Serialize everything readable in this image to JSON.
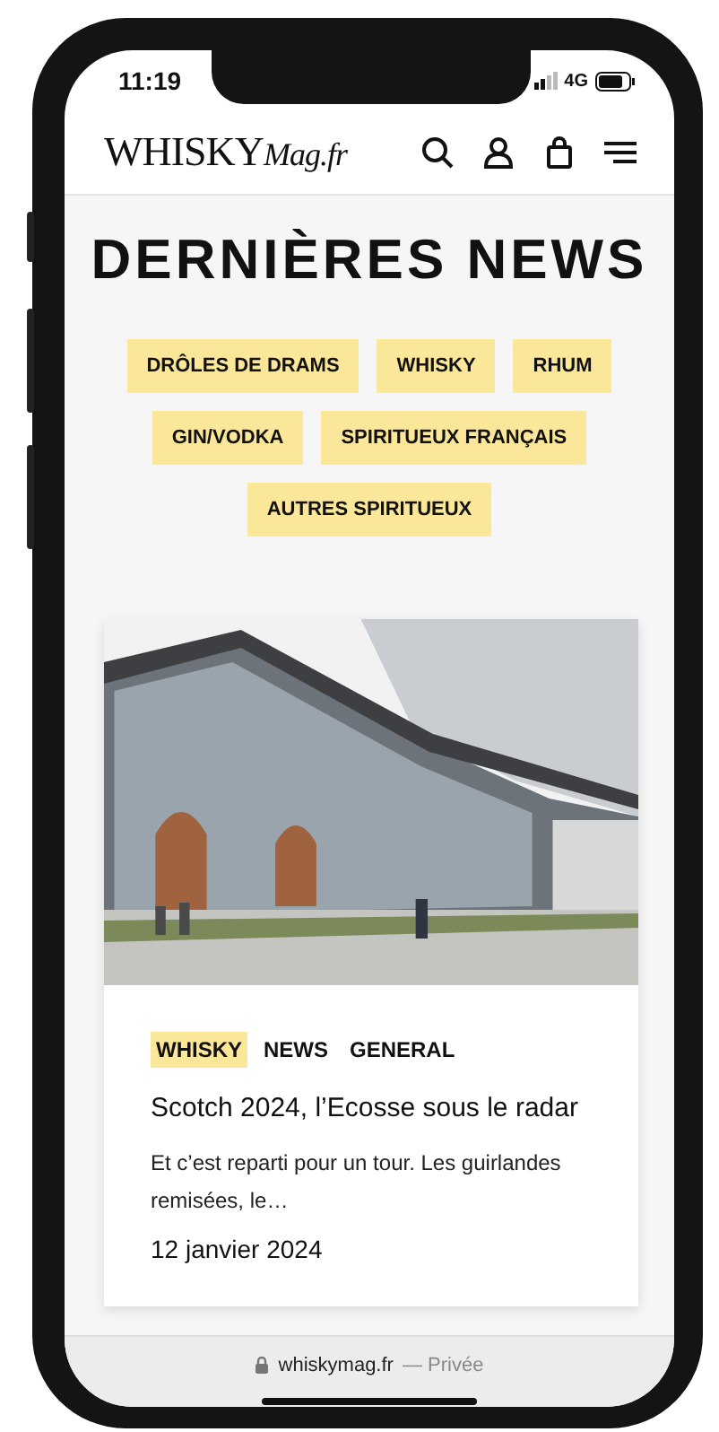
{
  "status_bar": {
    "time": "11:19",
    "network": "4G"
  },
  "header": {
    "logo": "WHISKY",
    "logo_suffix": "Mag.fr"
  },
  "page": {
    "title": "DERNIÈRES NEWS",
    "categories": [
      {
        "label": "DRÔLES DE DRAMS"
      },
      {
        "label": "WHISKY"
      },
      {
        "label": "RHUM"
      },
      {
        "label": "GIN/VODKA"
      },
      {
        "label": "SPIRITUEUX FRANÇAIS"
      },
      {
        "label": "AUTRES SPIRITUEUX"
      }
    ]
  },
  "articles": [
    {
      "tags": [
        {
          "label": "WHISKY",
          "highlighted": true
        },
        {
          "label": "NEWS",
          "highlighted": false
        },
        {
          "label": "GENERAL",
          "highlighted": false
        }
      ],
      "title": "Scotch 2024, l’Ecosse sous le radar",
      "excerpt": "Et c’est reparti pour un tour. Les guirlandes remisées, le…",
      "date": "12 janvier 2024"
    }
  ],
  "browser_bar": {
    "url": "whiskymag.fr",
    "mode": "— Privée"
  }
}
